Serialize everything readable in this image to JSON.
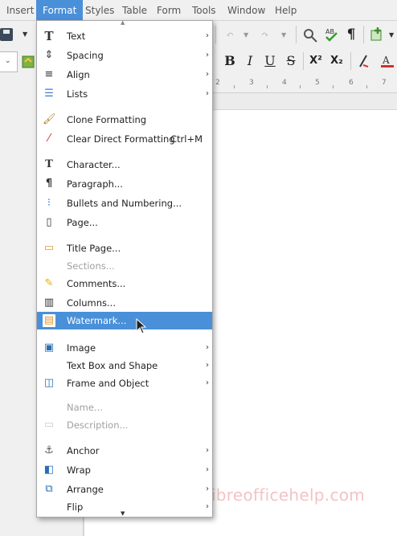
{
  "menubar": {
    "items": [
      "Insert",
      "Format",
      "Styles",
      "Table",
      "Form",
      "Tools",
      "Window",
      "Help"
    ],
    "active": "Format"
  },
  "toolbar": {
    "bold": "B",
    "italic": "I",
    "underline": "U",
    "strike": "S",
    "superscript": "X²",
    "subscript": "X₂",
    "formatting_marks": "¶"
  },
  "ruler": {
    "ticks": [
      "2",
      "3",
      "4",
      "5",
      "6",
      "7"
    ]
  },
  "format_menu": {
    "items": [
      {
        "label": "Text",
        "icon": "text-icon",
        "submenu": true
      },
      {
        "label": "Spacing",
        "icon": "spacing-icon",
        "submenu": true
      },
      {
        "label": "Align",
        "icon": "align-icon",
        "submenu": true
      },
      {
        "label": "Lists",
        "icon": "lists-icon",
        "submenu": true
      },
      {
        "label": "Clone Formatting",
        "icon": "paintbrush-icon"
      },
      {
        "label": "Clear Direct Formatting",
        "icon": "clear-formatting-icon",
        "shortcut": "Ctrl+M"
      },
      {
        "label": "Character...",
        "icon": "character-icon"
      },
      {
        "label": "Paragraph...",
        "icon": "paragraph-icon"
      },
      {
        "label": "Bullets and Numbering...",
        "icon": "bullets-numbering-icon"
      },
      {
        "label": "Page...",
        "icon": "page-icon"
      },
      {
        "label": "Title Page...",
        "icon": "title-page-icon"
      },
      {
        "label": "Sections...",
        "disabled": true
      },
      {
        "label": "Comments...",
        "icon": "comments-icon"
      },
      {
        "label": "Columns...",
        "icon": "columns-icon"
      },
      {
        "label": "Watermark...",
        "icon": "watermark-icon",
        "highlighted": true
      },
      {
        "label": "Image",
        "icon": "image-icon",
        "submenu": true
      },
      {
        "label": "Text Box and Shape",
        "submenu": true
      },
      {
        "label": "Frame and Object",
        "icon": "frame-icon",
        "submenu": true
      },
      {
        "label": "Name...",
        "disabled": true
      },
      {
        "label": "Description...",
        "disabled": true
      },
      {
        "label": "Anchor",
        "icon": "anchor-icon",
        "submenu": true
      },
      {
        "label": "Wrap",
        "icon": "wrap-icon",
        "submenu": true
      },
      {
        "label": "Arrange",
        "icon": "arrange-icon",
        "submenu": true
      },
      {
        "label": "Flip",
        "submenu": true
      }
    ]
  },
  "watermark_text": "libreofficehelp.com",
  "colors": {
    "accent": "#4a90d9",
    "watermark": "#f4c3c3"
  }
}
